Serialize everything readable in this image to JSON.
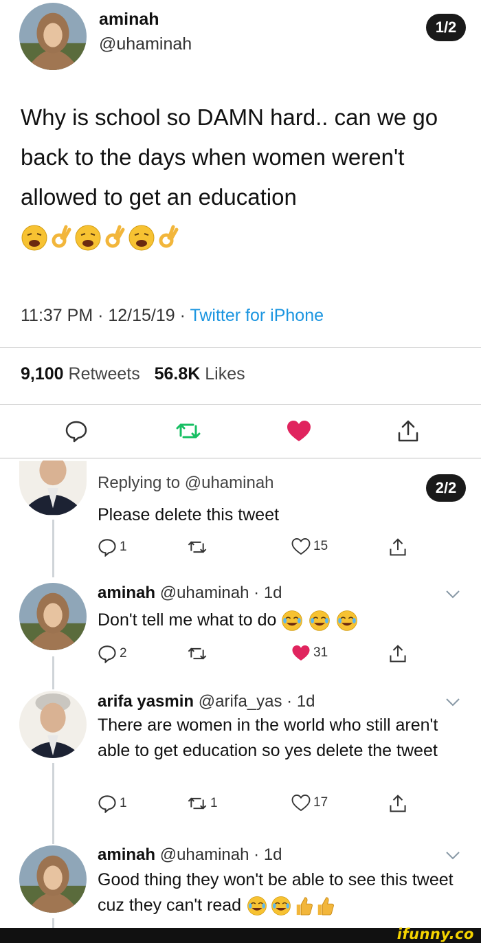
{
  "main_tweet": {
    "name": "aminah",
    "handle": "@uhaminah",
    "page_indicator": "1/2",
    "text": "Why is school so DAMN hard.. can we go back to the days when women weren't allowed to get an education",
    "emojis": [
      "weary-face",
      "ok-hand",
      "weary-face",
      "ok-hand",
      "weary-face",
      "ok-hand"
    ],
    "time": "11:37 PM",
    "date": "12/15/19",
    "separator": " · ",
    "source": "Twitter for iPhone",
    "retweets_count": "9,100",
    "retweets_label": "Retweets",
    "likes_count": "56.8K",
    "likes_label": "Likes",
    "icons": [
      "reply-icon",
      "retweet-icon",
      "heart-icon",
      "share-icon"
    ],
    "colors": {
      "retweet": "#17bf63",
      "like": "#e0245e",
      "link": "#1b95e0"
    }
  },
  "replies": [
    {
      "page_indicator": "2/2",
      "replying_to": "Replying to @uhaminah",
      "text": "Please delete this tweet",
      "reply_count": "1",
      "retweet_count": "",
      "like_count": "15",
      "liked": false
    },
    {
      "name": "aminah",
      "handle": "@uhaminah",
      "time": "· 1d",
      "text": "Don't tell me what to do",
      "emojis": [
        "joy-face",
        "joy-face",
        "joy-face"
      ],
      "reply_count": "2",
      "retweet_count": "",
      "like_count": "31",
      "liked": true
    },
    {
      "name": "arifa yasmin",
      "handle": "@arifa_yas",
      "time": "· 1d",
      "text": "There are women in the world who still aren't able to get education so yes delete the tweet",
      "reply_count": "1",
      "retweet_count": "1",
      "like_count": "17",
      "liked": false
    },
    {
      "name": "aminah",
      "handle": "@uhaminah",
      "time": "· 1d",
      "text": "Good thing they won't be able to see this tweet cuz they can't read",
      "emojis": [
        "joy-face",
        "joy-face",
        "thumbs-up",
        "thumbs-up"
      ]
    }
  ],
  "watermark": "ifunny.co"
}
